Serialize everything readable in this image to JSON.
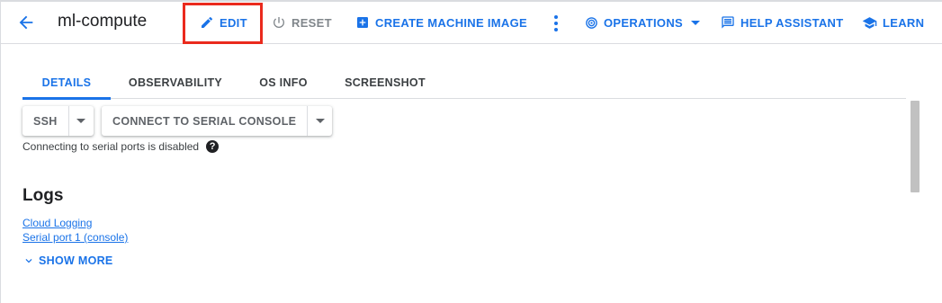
{
  "header": {
    "title": "ml-compute",
    "edit_label": "EDIT",
    "reset_label": "RESET",
    "create_image_label": "CREATE MACHINE IMAGE",
    "operations_label": "OPERATIONS",
    "help_assistant_label": "HELP ASSISTANT",
    "learn_label": "LEARN"
  },
  "tabs": [
    {
      "label": "DETAILS",
      "active": true
    },
    {
      "label": "OBSERVABILITY",
      "active": false
    },
    {
      "label": "OS INFO",
      "active": false
    },
    {
      "label": "SCREENSHOT",
      "active": false
    }
  ],
  "connect": {
    "ssh_label": "SSH",
    "serial_console_label": "CONNECT TO SERIAL CONSOLE",
    "serial_disabled_note": "Connecting to serial ports is disabled",
    "help_glyph": "?"
  },
  "logs": {
    "title": "Logs",
    "links": [
      "Cloud Logging",
      "Serial port 1 (console)"
    ],
    "show_more_label": "SHOW MORE"
  },
  "colors": {
    "accent": "#1a73e8",
    "highlight": "#ea2a1d",
    "disabled": "#80868b"
  }
}
